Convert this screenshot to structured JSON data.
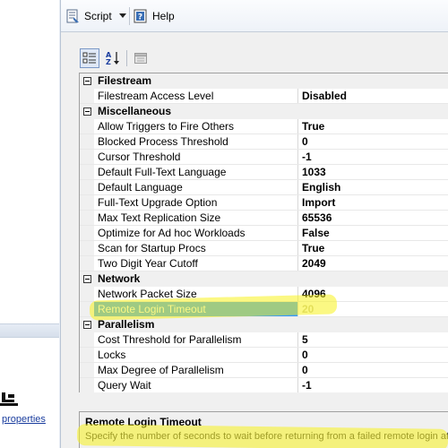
{
  "left_pane": {
    "link_text": "properties"
  },
  "toolbar": {
    "script_label": "Script",
    "help_label": "Help",
    "icons": {
      "script": "script-icon",
      "dropdown": "chevron-down-icon",
      "help": "help-icon"
    }
  },
  "grid_toolbar": {
    "icons": [
      "categorized-icon",
      "alphabetical-sort-icon",
      "property-pages-icon"
    ]
  },
  "property_grid": {
    "categories": [
      {
        "label": "Filestream",
        "properties": [
          {
            "name": "Filestream Access Level",
            "value": "Disabled"
          }
        ]
      },
      {
        "label": "Miscellaneous",
        "properties": [
          {
            "name": "Allow Triggers to Fire Others",
            "value": "True"
          },
          {
            "name": "Blocked Process Threshold",
            "value": "0"
          },
          {
            "name": "Cursor Threshold",
            "value": "-1"
          },
          {
            "name": "Default Full-Text Language",
            "value": "1033"
          },
          {
            "name": "Default Language",
            "value": "English"
          },
          {
            "name": "Full-Text Upgrade Option",
            "value": "Import"
          },
          {
            "name": "Max Text Replication Size",
            "value": "65536"
          },
          {
            "name": "Optimize for Ad hoc Workloads",
            "value": "False"
          },
          {
            "name": "Scan for Startup Procs",
            "value": "True"
          },
          {
            "name": "Two Digit Year Cutoff",
            "value": "2049"
          }
        ]
      },
      {
        "label": "Network",
        "properties": [
          {
            "name": "Network Packet Size",
            "value": "4096"
          },
          {
            "name": "Remote Login Timeout",
            "value": "20"
          }
        ]
      },
      {
        "label": "Parallelism",
        "properties": [
          {
            "name": "Cost Threshold for Parallelism",
            "value": "5"
          },
          {
            "name": "Locks",
            "value": "0"
          },
          {
            "name": "Max Degree of Parallelism",
            "value": "0"
          },
          {
            "name": "Query Wait",
            "value": "-1"
          }
        ]
      }
    ]
  },
  "description": {
    "title": "Remote Login Timeout",
    "text": "Specify the number of seconds to wait before returning from a failed remote login attempt."
  },
  "colors": {
    "selection": "#3399ff",
    "highlighter": "#f8f21e",
    "link": "#1a3d9e"
  }
}
